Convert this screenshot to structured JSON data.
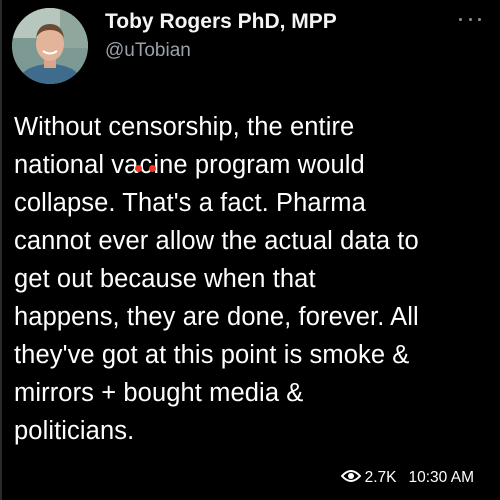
{
  "author": {
    "display_name": "Toby Rogers PhD, MPP",
    "handle": "@uTobian"
  },
  "tweet": {
    "lines": [
      "Without censorship, the entire",
      "program would",
      "collapse. That's a fact. Pharma",
      "cannot ever allow the actual data to",
      "get out because when that",
      "happens, they are done, forever. All",
      "they've got at this point is smoke &",
      "mirrors + bought media &",
      "politicians."
    ],
    "line2_prefix": "national va",
    "line2_mid1": "c",
    "line2_mid2": "ine"
  },
  "meta": {
    "views": "2.7K",
    "time": "10:30 AM"
  },
  "icons": {
    "more": "more-horizontal-icon",
    "views": "eye-icon",
    "annotation": "red-dot-marks"
  },
  "colors": {
    "background": "#000000",
    "text": "#ffffff",
    "secondary": "#9aa1a8",
    "annotation_dot": "#e8392a"
  }
}
